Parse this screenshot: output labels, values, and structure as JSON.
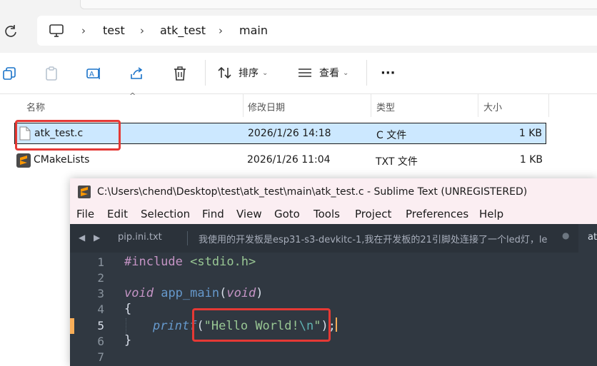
{
  "explorer": {
    "breadcrumb": [
      "test",
      "atk_test",
      "main"
    ],
    "toolbar": {
      "sort_label": "排序",
      "view_label": "查看",
      "more_label": "···"
    },
    "columns": {
      "name": "名称",
      "modified": "修改日期",
      "type": "类型",
      "size": "大小"
    },
    "files": [
      {
        "name": "atk_test.c",
        "modified": "2026/1/26 14:18",
        "type": "C 文件",
        "size": "1 KB",
        "selected": true
      },
      {
        "name": "CMakeLists",
        "modified": "2026/1/26 11:04",
        "type": "TXT 文件",
        "size": "1 KB",
        "selected": false
      }
    ]
  },
  "sublime": {
    "title": "C:\\Users\\chend\\Desktop\\test\\atk_test\\main\\atk_test.c - Sublime Text (UNREGISTERED)",
    "menu": [
      "File",
      "Edit",
      "Selection",
      "Find",
      "View",
      "Goto",
      "Tools",
      "Project",
      "Preferences",
      "Help"
    ],
    "tab_arrows": "◀ ▶",
    "tabs": [
      "pip.ini.txt",
      "我使用的开发板是esp31-s3-devkitc-1,我在开发板的21引脚处连接了一个led灯，le",
      "at"
    ],
    "line_numbers": [
      "1",
      "2",
      "3",
      "4",
      "5",
      "6",
      "7"
    ],
    "current_line": 5,
    "code": {
      "include": "#include",
      "header": "<stdio.h>",
      "void1": "void",
      "func": "app_main",
      "paren_open": "(",
      "void2": "void",
      "paren_close": ")",
      "brace_open": "{",
      "call": "printf",
      "call_open": "(",
      "str_text": "\"Hello World!",
      "str_esc": "\\n",
      "str_end": "\"",
      "call_close": ");",
      "brace_close": "}"
    },
    "colors": {
      "background": "#303841",
      "keyword": "#c594c5",
      "string": "#99c794",
      "function": "#6699cc",
      "highlight": "#f9ae58"
    }
  }
}
